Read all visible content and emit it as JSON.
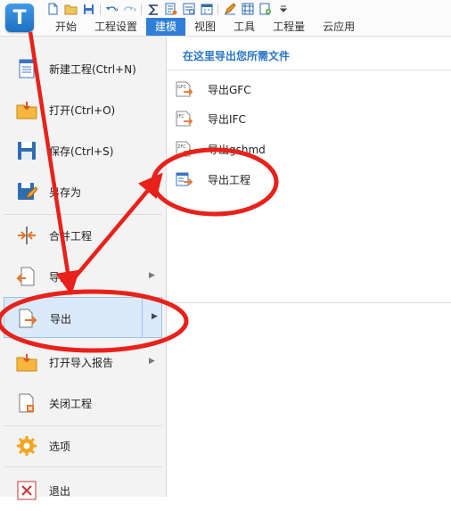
{
  "app": {
    "logo_letter": "T"
  },
  "ribbon": {
    "quick_access": [
      "new-icon",
      "open-icon",
      "save-icon",
      "undo-icon",
      "redo-icon",
      "sum-icon",
      "calc-icon",
      "report-icon",
      "calendar-icon",
      "edit-icon",
      "grid-icon",
      "add-icon",
      "customize-icon"
    ],
    "tabs": [
      {
        "label": "开始",
        "active": false
      },
      {
        "label": "工程设置",
        "active": false
      },
      {
        "label": "建模",
        "active": true
      },
      {
        "label": "视图",
        "active": false
      },
      {
        "label": "工具",
        "active": false
      },
      {
        "label": "工程量",
        "active": false
      },
      {
        "label": "云应用",
        "active": false
      }
    ]
  },
  "file_menu": {
    "items": [
      {
        "label": "新建工程(Ctrl+N)",
        "icon": "new-project-icon",
        "has_submenu": false
      },
      {
        "label": "打开(Ctrl+O)",
        "icon": "open-folder-icon",
        "has_submenu": false
      },
      {
        "label": "保存(Ctrl+S)",
        "icon": "save-icon",
        "has_submenu": false
      },
      {
        "label": "另存为",
        "icon": "save-as-icon",
        "has_submenu": false
      },
      {
        "label": "合并工程",
        "icon": "merge-icon",
        "has_submenu": false
      },
      {
        "label": "导入",
        "icon": "import-icon",
        "has_submenu": true
      },
      {
        "label": "导出",
        "icon": "export-icon",
        "has_submenu": true,
        "active": true
      },
      {
        "label": "打开导入报告",
        "icon": "import-report-icon",
        "has_submenu": true
      },
      {
        "label": "关闭工程",
        "icon": "close-project-icon",
        "has_submenu": false
      },
      {
        "label": "选项",
        "icon": "gear-icon",
        "has_submenu": false
      },
      {
        "label": "退出",
        "icon": "exit-icon",
        "has_submenu": false
      }
    ]
  },
  "export_panel": {
    "title": "在这里导出您所需文件",
    "items": [
      {
        "label": "导出GFC",
        "icon": "gfc-file-icon",
        "badge": "GFC"
      },
      {
        "label": "导出IFC",
        "icon": "ifc-file-icon",
        "badge": "IFC"
      },
      {
        "label": "导出gshmd",
        "icon": "gshmd-file-icon",
        "badge": "ZFC"
      },
      {
        "label": "导出工程",
        "icon": "export-project-icon",
        "badge": ""
      }
    ]
  },
  "colors": {
    "accent": "#2f7ed8",
    "annotation": "#e8211a",
    "active_bg": "#dbeafb"
  }
}
